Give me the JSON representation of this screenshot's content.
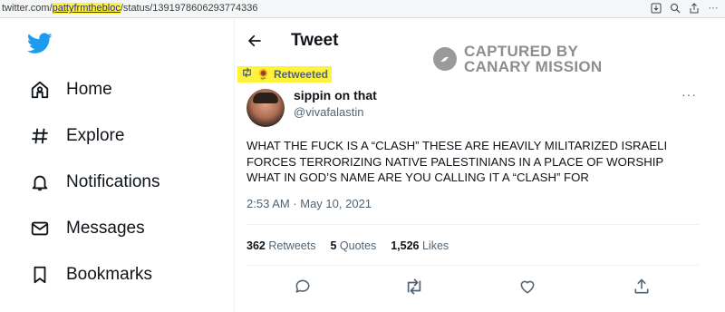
{
  "browser": {
    "url_prefix": "twitter.com/",
    "url_highlight": "pattyfrmthebloc",
    "url_suffix": "/status/1391978606293774336",
    "icons": [
      "download-icon",
      "zoom-icon",
      "share-icon",
      "more-icon"
    ]
  },
  "sidebar": {
    "items": [
      {
        "label": "Home",
        "icon": "home-icon"
      },
      {
        "label": "Explore",
        "icon": "hashtag-icon"
      },
      {
        "label": "Notifications",
        "icon": "bell-icon"
      },
      {
        "label": "Messages",
        "icon": "envelope-icon"
      },
      {
        "label": "Bookmarks",
        "icon": "bookmark-icon"
      }
    ]
  },
  "header": {
    "title": "Tweet"
  },
  "watermark": {
    "line1": "CAPTURED BY",
    "line2": "CANARY MISSION"
  },
  "retweet": {
    "label": "Retweeted",
    "emoji": "🌻"
  },
  "tweet": {
    "author_name": "sippin on that",
    "author_handle": "@vivafalastin",
    "text": "WHAT THE FUCK IS A “CLASH” THESE ARE HEAVILY MILITARIZED ISRAELI FORCES TERRORIZING NATIVE PALESTINIANS IN A PLACE OF WORSHIP WHAT IN GOD’S NAME ARE YOU CALLING IT A “CLASH” FOR",
    "timestamp": "2:53 AM · May 10, 2021"
  },
  "stats": {
    "retweets_count": "362",
    "retweets_label": "Retweets",
    "quotes_count": "5",
    "quotes_label": "Quotes",
    "likes_count": "1,526",
    "likes_label": "Likes"
  },
  "colors": {
    "twitter_blue": "#1d9bf0",
    "highlight": "#fff23a",
    "muted": "#536471"
  }
}
